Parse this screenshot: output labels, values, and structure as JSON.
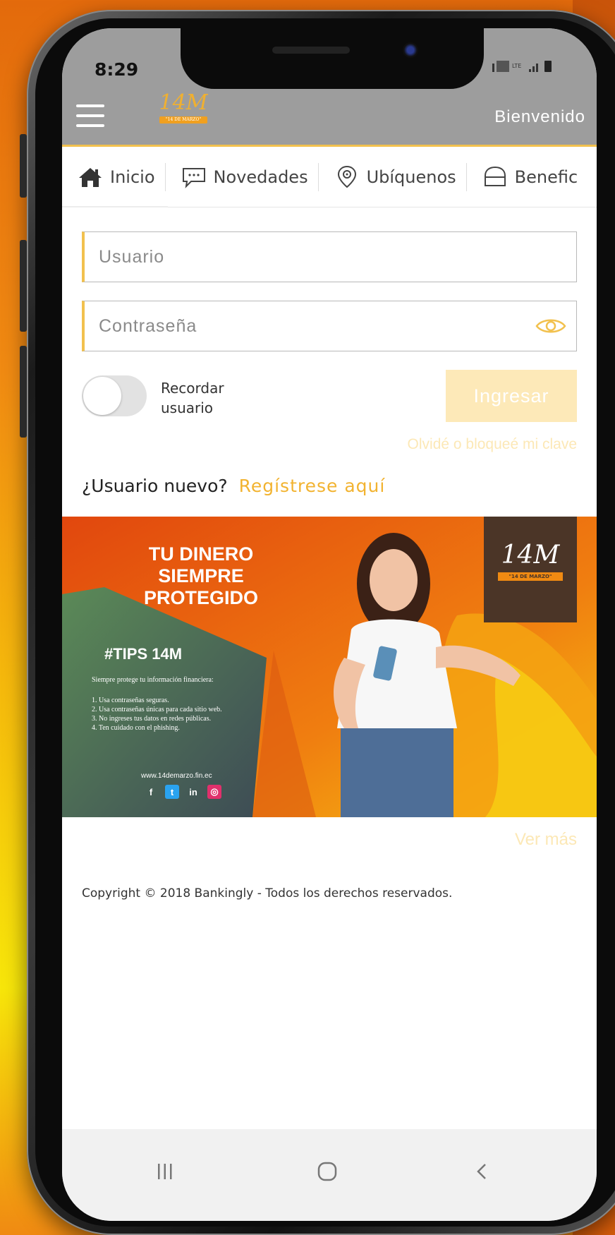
{
  "status_bar": {
    "time": "8:29"
  },
  "header": {
    "welcome": "Bienvenido",
    "logo_text": "14M",
    "logo_sub": "\"14 DE MARZO\""
  },
  "tabs": [
    {
      "label": "Inicio",
      "icon": "home-icon"
    },
    {
      "label": "Novedades",
      "icon": "chat-icon"
    },
    {
      "label": "Ubíquenos",
      "icon": "location-pin-icon"
    },
    {
      "label": "Benefic",
      "icon": "bag-icon"
    }
  ],
  "login": {
    "user_placeholder": "Usuario",
    "password_placeholder": "Contraseña",
    "remember_label_1": "Recordar",
    "remember_label_2": "usuario",
    "remember_on": false,
    "submit_label": "Ingresar",
    "forgot_link": "Olvidé o bloqueé mi clave",
    "new_user_text": "¿Usuario nuevo?",
    "register_link": "Regístrese aquí"
  },
  "banner": {
    "title_lines": [
      "TU DINERO",
      "SIEMPRE",
      "PROTEGIDO"
    ],
    "tips_title": "#TIPS 14M",
    "tips_intro": "Siempre protege tu información financiera:",
    "tips": [
      "1. Usa contraseñas seguras.",
      "2. Usa contraseñas únicas para cada sitio web.",
      "3. No ingreses tus datos en redes públicas.",
      "4. Ten cuidado con el phishing."
    ],
    "url": "www.14demarzo.fin.ec",
    "logo_text": "14M",
    "logo_sub": "\"14 DE MARZO\""
  },
  "see_more": "Ver más",
  "footer": {
    "copyright": "Copyright © 2018 Bankingly - Todos los derechos reservados."
  },
  "colors": {
    "accent": "#f2c14e",
    "header_gray": "#9d9d9d",
    "button_disabled": "#fde9b8"
  }
}
